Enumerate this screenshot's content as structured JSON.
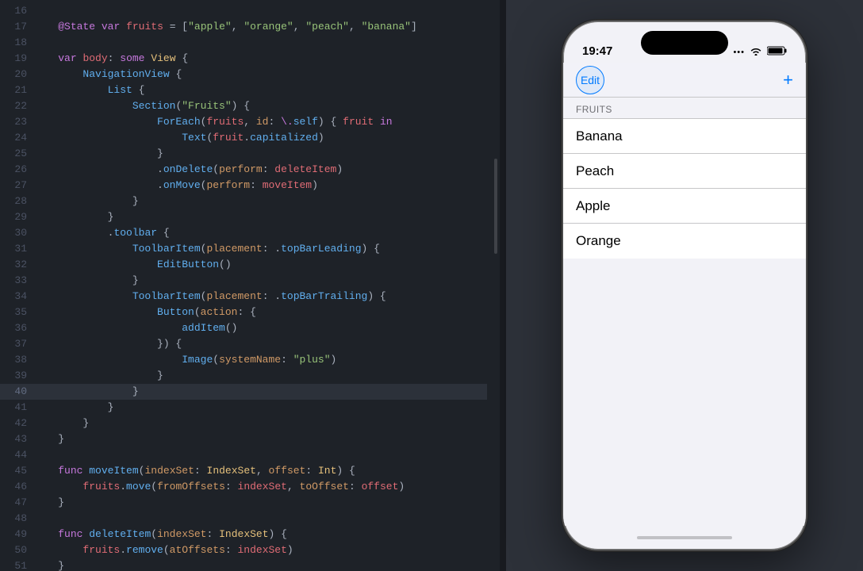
{
  "editor": {
    "background": "#1e2228",
    "lines": [
      {
        "num": 16,
        "content": ""
      },
      {
        "num": 17,
        "content": "    @State var fruits = [\"apple\", \"orange\", \"peach\", \"banana\"]"
      },
      {
        "num": 18,
        "content": ""
      },
      {
        "num": 19,
        "content": "    var body: some View {"
      },
      {
        "num": 20,
        "content": "        NavigationView {"
      },
      {
        "num": 21,
        "content": "            List {"
      },
      {
        "num": 22,
        "content": "                Section(\"Fruits\") {"
      },
      {
        "num": 23,
        "content": "                    ForEach(fruits, id: \\.self) { fruit in"
      },
      {
        "num": 24,
        "content": "                        Text(fruit.capitalized)"
      },
      {
        "num": 25,
        "content": "                    }"
      },
      {
        "num": 26,
        "content": "                    .onDelete(perform: deleteItem)"
      },
      {
        "num": 27,
        "content": "                    .onMove(perform: moveItem)"
      },
      {
        "num": 28,
        "content": "                }"
      },
      {
        "num": 29,
        "content": "            }"
      },
      {
        "num": 30,
        "content": "            .toolbar {"
      },
      {
        "num": 31,
        "content": "                ToolbarItem(placement: .topBarLeading) {"
      },
      {
        "num": 32,
        "content": "                    EditButton()"
      },
      {
        "num": 33,
        "content": "                }"
      },
      {
        "num": 34,
        "content": "                ToolbarItem(placement: .topBarTrailing) {"
      },
      {
        "num": 35,
        "content": "                    Button(action: {"
      },
      {
        "num": 36,
        "content": "                        addItem()"
      },
      {
        "num": 37,
        "content": "                    }) {"
      },
      {
        "num": 38,
        "content": "                        Image(systemName: \"plus\")"
      },
      {
        "num": 39,
        "content": "                    }"
      },
      {
        "num": 40,
        "content": "                }",
        "highlighted": true
      },
      {
        "num": 41,
        "content": "            }"
      },
      {
        "num": 42,
        "content": "        }"
      },
      {
        "num": 43,
        "content": "    }"
      },
      {
        "num": 44,
        "content": ""
      },
      {
        "num": 45,
        "content": "    func moveItem(indexSet: IndexSet, offset: Int) {"
      },
      {
        "num": 46,
        "content": "        fruits.move(fromOffsets: indexSet, toOffset: offset)"
      },
      {
        "num": 47,
        "content": "    }"
      },
      {
        "num": 48,
        "content": ""
      },
      {
        "num": 49,
        "content": "    func deleteItem(indexSet: IndexSet) {"
      },
      {
        "num": 50,
        "content": "        fruits.remove(atOffsets: indexSet)"
      },
      {
        "num": 51,
        "content": "    }"
      }
    ]
  },
  "phone": {
    "time": "19:47",
    "nav": {
      "edit_label": "Edit",
      "plus_icon": "+"
    },
    "section_header": "FRUITS",
    "list_items": [
      "Banana",
      "Peach",
      "Apple",
      "Orange"
    ]
  }
}
